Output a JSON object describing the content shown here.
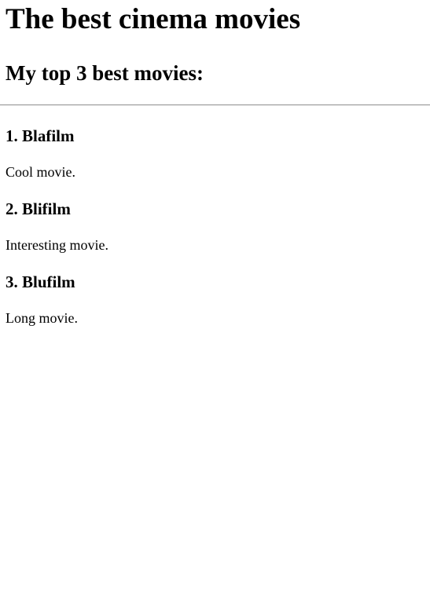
{
  "page": {
    "title": "The best cinema movies",
    "subtitle": "My top 3 best movies:"
  },
  "movies": [
    {
      "heading": "1. Blafilm",
      "description": "Cool movie."
    },
    {
      "heading": "2. Blifilm",
      "description": "Interesting movie."
    },
    {
      "heading": "3. Blufilm",
      "description": "Long movie."
    }
  ]
}
